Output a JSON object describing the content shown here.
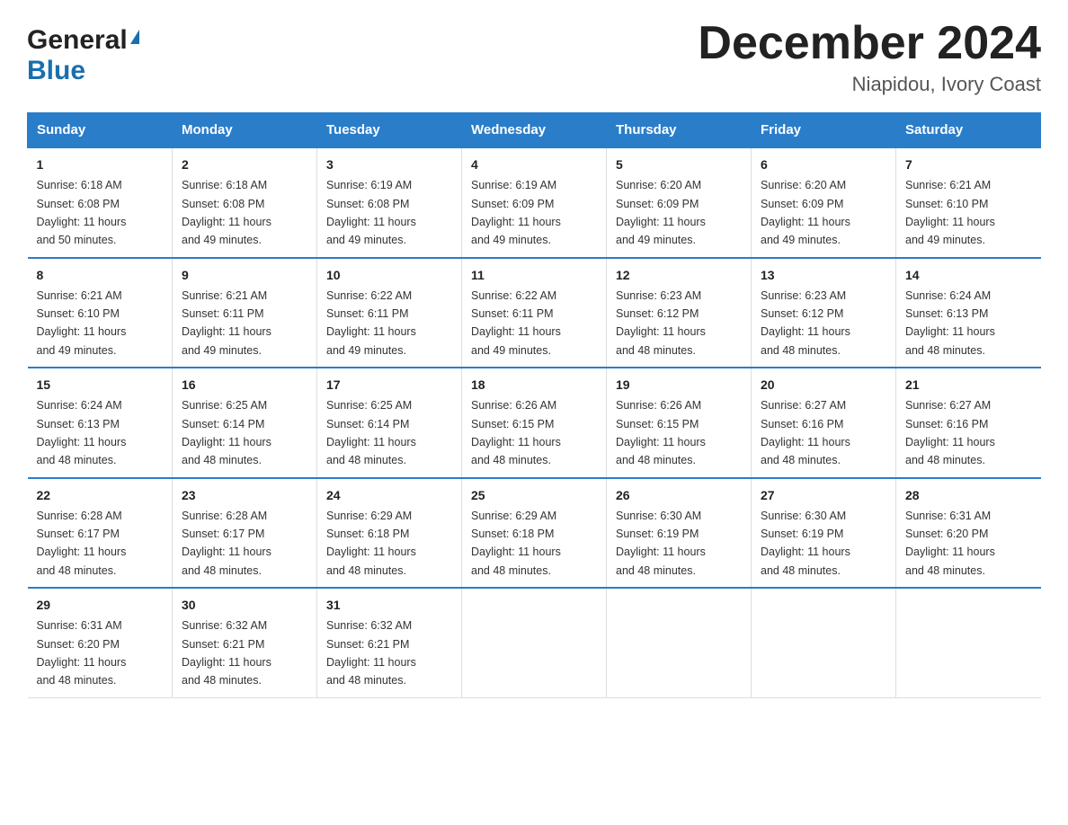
{
  "header": {
    "logo": {
      "general": "General",
      "blue": "Blue",
      "triangle": true
    },
    "title": "December 2024",
    "location": "Niapidou, Ivory Coast"
  },
  "calendar": {
    "headers": [
      "Sunday",
      "Monday",
      "Tuesday",
      "Wednesday",
      "Thursday",
      "Friday",
      "Saturday"
    ],
    "weeks": [
      [
        {
          "day": "1",
          "sunrise": "6:18 AM",
          "sunset": "6:08 PM",
          "daylight": "11 hours and 50 minutes."
        },
        {
          "day": "2",
          "sunrise": "6:18 AM",
          "sunset": "6:08 PM",
          "daylight": "11 hours and 49 minutes."
        },
        {
          "day": "3",
          "sunrise": "6:19 AM",
          "sunset": "6:08 PM",
          "daylight": "11 hours and 49 minutes."
        },
        {
          "day": "4",
          "sunrise": "6:19 AM",
          "sunset": "6:09 PM",
          "daylight": "11 hours and 49 minutes."
        },
        {
          "day": "5",
          "sunrise": "6:20 AM",
          "sunset": "6:09 PM",
          "daylight": "11 hours and 49 minutes."
        },
        {
          "day": "6",
          "sunrise": "6:20 AM",
          "sunset": "6:09 PM",
          "daylight": "11 hours and 49 minutes."
        },
        {
          "day": "7",
          "sunrise": "6:21 AM",
          "sunset": "6:10 PM",
          "daylight": "11 hours and 49 minutes."
        }
      ],
      [
        {
          "day": "8",
          "sunrise": "6:21 AM",
          "sunset": "6:10 PM",
          "daylight": "11 hours and 49 minutes."
        },
        {
          "day": "9",
          "sunrise": "6:21 AM",
          "sunset": "6:11 PM",
          "daylight": "11 hours and 49 minutes."
        },
        {
          "day": "10",
          "sunrise": "6:22 AM",
          "sunset": "6:11 PM",
          "daylight": "11 hours and 49 minutes."
        },
        {
          "day": "11",
          "sunrise": "6:22 AM",
          "sunset": "6:11 PM",
          "daylight": "11 hours and 49 minutes."
        },
        {
          "day": "12",
          "sunrise": "6:23 AM",
          "sunset": "6:12 PM",
          "daylight": "11 hours and 48 minutes."
        },
        {
          "day": "13",
          "sunrise": "6:23 AM",
          "sunset": "6:12 PM",
          "daylight": "11 hours and 48 minutes."
        },
        {
          "day": "14",
          "sunrise": "6:24 AM",
          "sunset": "6:13 PM",
          "daylight": "11 hours and 48 minutes."
        }
      ],
      [
        {
          "day": "15",
          "sunrise": "6:24 AM",
          "sunset": "6:13 PM",
          "daylight": "11 hours and 48 minutes."
        },
        {
          "day": "16",
          "sunrise": "6:25 AM",
          "sunset": "6:14 PM",
          "daylight": "11 hours and 48 minutes."
        },
        {
          "day": "17",
          "sunrise": "6:25 AM",
          "sunset": "6:14 PM",
          "daylight": "11 hours and 48 minutes."
        },
        {
          "day": "18",
          "sunrise": "6:26 AM",
          "sunset": "6:15 PM",
          "daylight": "11 hours and 48 minutes."
        },
        {
          "day": "19",
          "sunrise": "6:26 AM",
          "sunset": "6:15 PM",
          "daylight": "11 hours and 48 minutes."
        },
        {
          "day": "20",
          "sunrise": "6:27 AM",
          "sunset": "6:16 PM",
          "daylight": "11 hours and 48 minutes."
        },
        {
          "day": "21",
          "sunrise": "6:27 AM",
          "sunset": "6:16 PM",
          "daylight": "11 hours and 48 minutes."
        }
      ],
      [
        {
          "day": "22",
          "sunrise": "6:28 AM",
          "sunset": "6:17 PM",
          "daylight": "11 hours and 48 minutes."
        },
        {
          "day": "23",
          "sunrise": "6:28 AM",
          "sunset": "6:17 PM",
          "daylight": "11 hours and 48 minutes."
        },
        {
          "day": "24",
          "sunrise": "6:29 AM",
          "sunset": "6:18 PM",
          "daylight": "11 hours and 48 minutes."
        },
        {
          "day": "25",
          "sunrise": "6:29 AM",
          "sunset": "6:18 PM",
          "daylight": "11 hours and 48 minutes."
        },
        {
          "day": "26",
          "sunrise": "6:30 AM",
          "sunset": "6:19 PM",
          "daylight": "11 hours and 48 minutes."
        },
        {
          "day": "27",
          "sunrise": "6:30 AM",
          "sunset": "6:19 PM",
          "daylight": "11 hours and 48 minutes."
        },
        {
          "day": "28",
          "sunrise": "6:31 AM",
          "sunset": "6:20 PM",
          "daylight": "11 hours and 48 minutes."
        }
      ],
      [
        {
          "day": "29",
          "sunrise": "6:31 AM",
          "sunset": "6:20 PM",
          "daylight": "11 hours and 48 minutes."
        },
        {
          "day": "30",
          "sunrise": "6:32 AM",
          "sunset": "6:21 PM",
          "daylight": "11 hours and 48 minutes."
        },
        {
          "day": "31",
          "sunrise": "6:32 AM",
          "sunset": "6:21 PM",
          "daylight": "11 hours and 48 minutes."
        },
        null,
        null,
        null,
        null
      ]
    ]
  }
}
